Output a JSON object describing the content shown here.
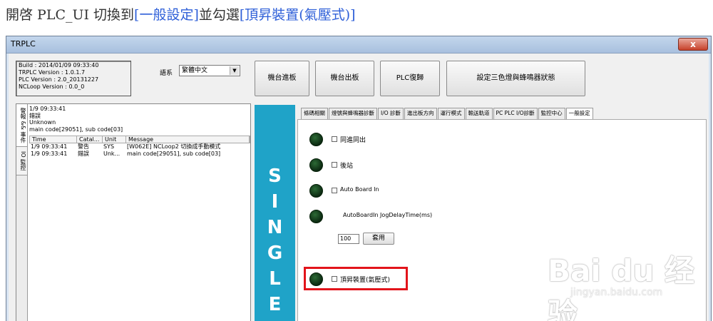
{
  "caption": {
    "prefix": "開啓 PLC_UI  切換到",
    "tab": "[一般設定]",
    "middle": "並勾選",
    "item": "[頂昇裝置(氣壓式)]"
  },
  "window": {
    "title": "TRPLC",
    "close_label": "x"
  },
  "info": {
    "build": "Build : 2014/01/09 09:33:40",
    "trplc_version": "TRPLC Version : 1.0.1.7",
    "plc_version": "PLC Version : 2.0_20131227",
    "ncloop_version": "NCLoop Version : 0.0_0"
  },
  "language": {
    "label": "語系",
    "value": "繁體中文"
  },
  "top_buttons": {
    "board_in": "機台進板",
    "board_out": "機台出板",
    "plc_reset": "PLC復歸",
    "tower_light": "設定三色燈與蜂鳴器狀態"
  },
  "left_tabs": {
    "alarm": "警報 && 事件",
    "io": "IO 監控"
  },
  "alarm": {
    "time": "1/9 09:33:41",
    "level": "錯誤",
    "status": "Unknown",
    "code": "main code[29051], sub code[03]"
  },
  "log_table": {
    "headers": [
      "Time",
      "Catal...",
      "Unit",
      "Message"
    ],
    "rows": [
      [
        "1/9 09:33:41",
        "警告",
        "SYS",
        "[W062E] NCLoop2 切換成手動模式"
      ],
      [
        "1/9 09:33:41",
        "錯誤",
        "Unk...",
        "main code[29051], sub code[03]"
      ]
    ]
  },
  "mode_letters": [
    "S",
    "I",
    "N",
    "G",
    "L",
    "E"
  ],
  "tabs": [
    {
      "label": "條碼相關",
      "active": false
    },
    {
      "label": "燈號與蜂鳴器診斷",
      "active": false
    },
    {
      "label": "I/O 診斷",
      "active": false
    },
    {
      "label": "進出板方向",
      "active": false
    },
    {
      "label": "運行模式",
      "active": false
    },
    {
      "label": "輸送軌道",
      "active": false
    },
    {
      "label": "PC PLC I/O診斷",
      "active": false
    },
    {
      "label": "監控中心",
      "active": false
    },
    {
      "label": "一般設定",
      "active": true
    }
  ],
  "options": {
    "same_in_out": "同進同出",
    "rear_station": "後站",
    "auto_board_in": "Auto Board In",
    "jog_delay_label": "AutoBoardIn JogDelayTime(ms)",
    "jog_delay_value": "100",
    "apply": "套用",
    "lift_device": "頂昇裝置(氣壓式)"
  },
  "watermark": {
    "brand": "Bai du 经验",
    "url": "jingyan.baidu.com"
  },
  "colors": {
    "single_panel": "#1fa3c8",
    "highlight_box": "#e2141b",
    "led": "#0c2a12",
    "caption_link": "#2e5fd8"
  }
}
